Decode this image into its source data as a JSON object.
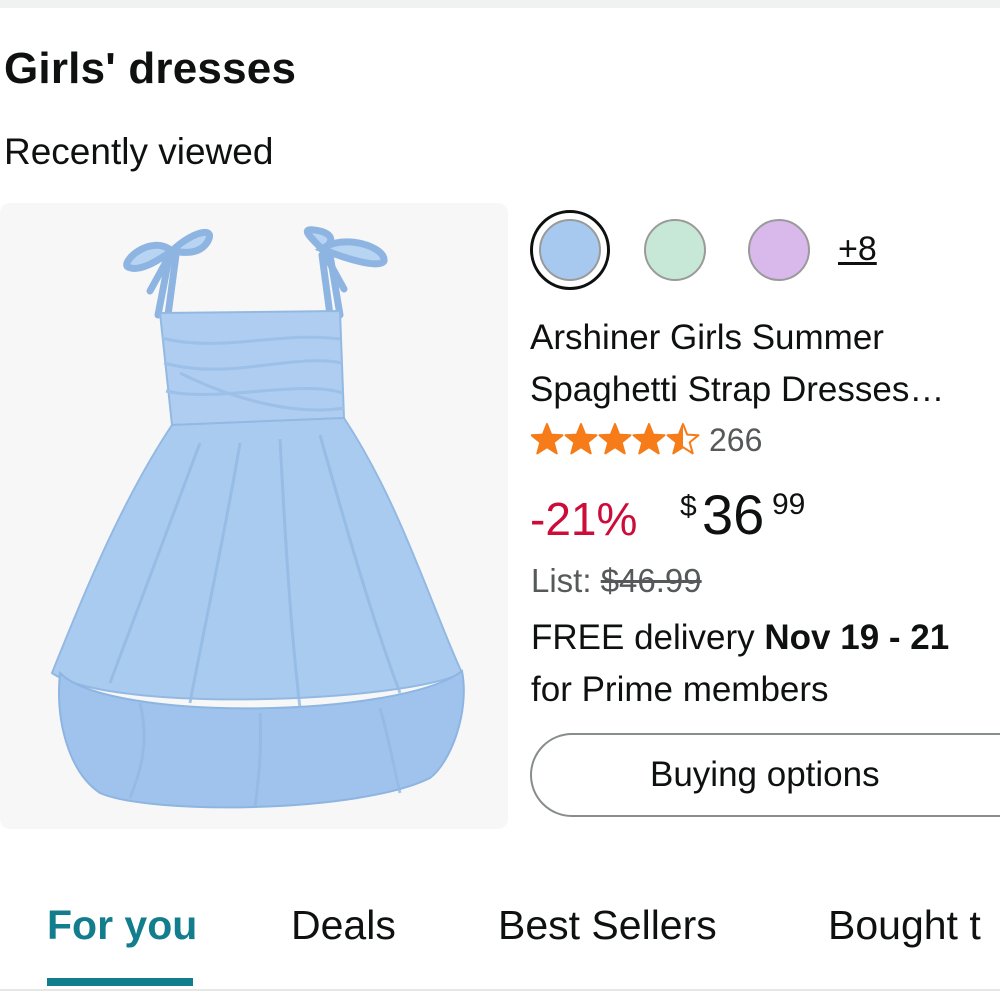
{
  "section": {
    "title": "Girls' dresses",
    "subtitle": "Recently viewed"
  },
  "product": {
    "image_alt": "light-blue-dress-photo",
    "swatches": [
      {
        "name": "light-blue",
        "color": "#a7c9f0",
        "selected": true
      },
      {
        "name": "mint-green",
        "color": "#c7e8d6",
        "selected": false
      },
      {
        "name": "lavender",
        "color": "#d9b8ec",
        "selected": false
      }
    ],
    "more_colors": "+8",
    "title": "Arshiner Girls Summer Spaghetti Strap Dresses…",
    "title_line1": "Arshiner Girls Summer",
    "title_line2": "Spaghetti Strap Dresses…",
    "rating": 4.5,
    "review_count": "266",
    "discount": "-21%",
    "price_symbol": "$",
    "price_whole": "36",
    "price_fraction": "99",
    "list_label": "List:",
    "list_price": "$46.99",
    "delivery_prefix": "FREE delivery ",
    "delivery_dates": "Nov 19 - 21",
    "delivery_suffix": "for Prime members",
    "button_label": "Buying options"
  },
  "tabs": [
    {
      "label": "For you",
      "active": true
    },
    {
      "label": "Deals",
      "active": false
    },
    {
      "label": "Best Sellers",
      "active": false
    },
    {
      "label": "Bought t",
      "active": false
    }
  ],
  "colors": {
    "accent_teal": "#127d8c",
    "discount_red": "#cc0c39",
    "star_orange": "#f57c18",
    "dress_blue": "#a7c9f0"
  }
}
